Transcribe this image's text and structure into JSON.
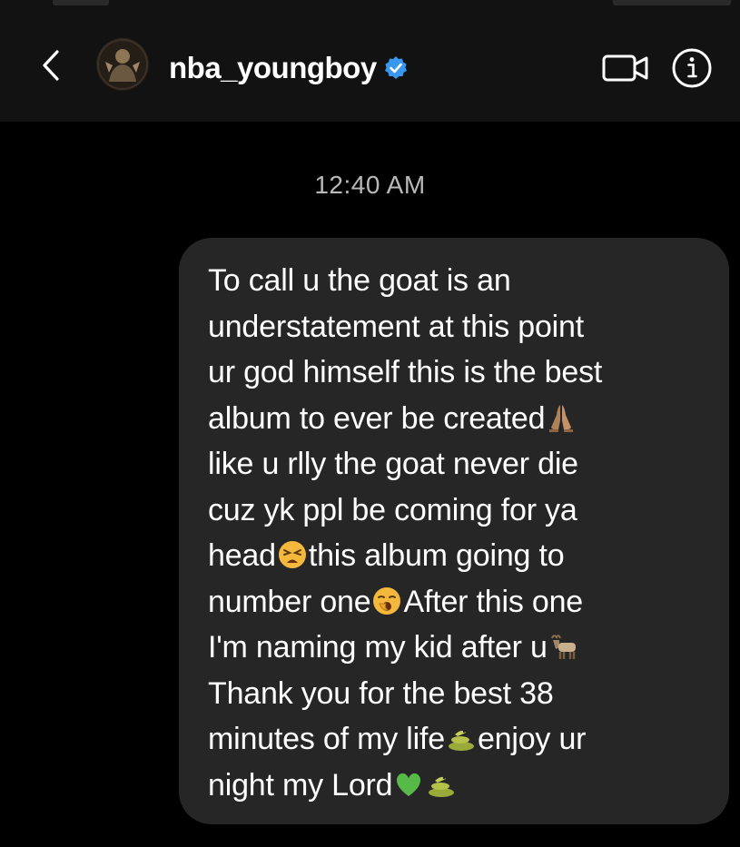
{
  "header": {
    "back_icon": "chevron-left-icon",
    "avatar_icon": "profile-avatar",
    "username": "nba_youngboy",
    "verified_icon": "verified-badge-icon",
    "video_icon": "video-camera-icon",
    "info_icon": "info-circle-icon",
    "colors": {
      "background": "#121212",
      "text": "#ffffff",
      "verified": "#3897f0"
    }
  },
  "conversation": {
    "timestamp": "12:40 AM",
    "message": {
      "bubble_color": "#262626",
      "lines": [
        {
          "text": "To call u the goat is an"
        },
        {
          "text": "understatement at this point"
        },
        {
          "text": "ur god himself this is the best"
        },
        {
          "text": "album to ever be created",
          "emoji_after": "folded-hands-emoji"
        },
        {
          "text": "like u rlly the goat never die"
        },
        {
          "text": "cuz yk ppl be coming for ya"
        },
        {
          "text": "head",
          "emoji_after": "tired-face-emoji",
          "text_after": "this album going to"
        },
        {
          "text": "number one",
          "emoji_after": "yawning-face-emoji",
          "text_after": "After this one"
        },
        {
          "text": "I'm naming my kid after u",
          "emoji_after": "goat-emoji"
        },
        {
          "text": "Thank you for the best 38"
        },
        {
          "text": "minutes of my life",
          "emoji_after": "snake-emoji",
          "text_after": "enjoy ur"
        },
        {
          "text": "night my Lord",
          "emoji_after": "green-heart-emoji",
          "emoji_after_2": "snake-emoji"
        }
      ]
    }
  }
}
